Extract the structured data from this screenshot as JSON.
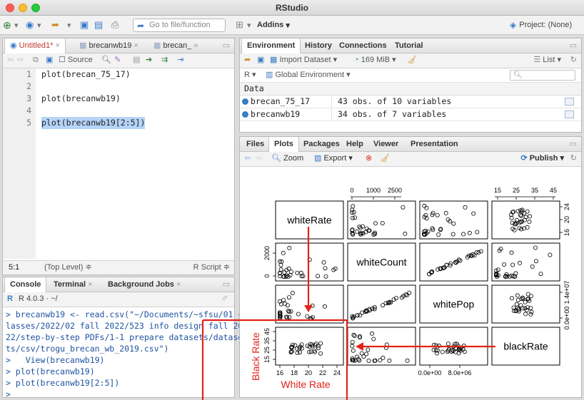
{
  "window": {
    "title": "RStudio"
  },
  "toolbar": {
    "goto_placeholder": "Go to file/function",
    "addins": "Addins",
    "project": "Project: (None)"
  },
  "editor": {
    "tabs": [
      "Untitled1*",
      "brecanwb19",
      "brecan_"
    ],
    "source_label": "Source",
    "lines": [
      {
        "n": "1",
        "code": "plot(brecan_75_17)"
      },
      {
        "n": "2",
        "code": ""
      },
      {
        "n": "3",
        "code": "plot(brecanwb19)"
      },
      {
        "n": "4",
        "code": ""
      },
      {
        "n": "5",
        "code": "plot(brecanwb19[2:5])"
      }
    ],
    "status_pos": "5:1",
    "status_scope": "(Top Level) ≑",
    "status_type": "R Script ≑"
  },
  "console": {
    "tabs": [
      "Console",
      "Terminal",
      "Background Jobs"
    ],
    "version": "R 4.0.3 · ~/",
    "lines": [
      "> brecanwb19 <- read.csv(\"~/Documents/~sfsu/01 c",
      "lasses/2022/02 fall 2022/523 info design fall 20",
      "22/step-by-step PDFs/1-1 prepare datasets/datase",
      "ts/csv/trogu_brecan_wb_2019.csv\")",
      ">   View(brecanwb19)",
      "> plot(brecanwb19)",
      "> plot(brecanwb19[2:5])",
      "> "
    ]
  },
  "environment": {
    "tabs": [
      "Environment",
      "History",
      "Connections",
      "Tutorial"
    ],
    "import_label": "Import Dataset",
    "memory": "169 MiB",
    "list_label": "List",
    "r_label": "R",
    "global_label": "Global Environment",
    "section": "Data",
    "rows": [
      {
        "name": "brecan_75_17",
        "desc": "43 obs. of 10 variables"
      },
      {
        "name": "brecanwb19",
        "desc": "34 obs. of 7 variables"
      }
    ]
  },
  "files": {
    "tabs": [
      "Files",
      "Plots",
      "Packages",
      "Help",
      "Viewer",
      "Presentation"
    ],
    "zoom": "Zoom",
    "export": "Export",
    "publish": "Publish"
  },
  "chart_data": {
    "type": "scatter",
    "variables": [
      "whiteRate",
      "whiteCount",
      "whitePop",
      "blackRate"
    ],
    "top_axis_ticks": [
      [
        "0",
        "1000",
        "2500"
      ],
      [
        "15",
        "25",
        "35",
        "45"
      ]
    ],
    "right_axis_ticks": [
      [
        "24",
        "20",
        "16"
      ],
      [
        "1.4e+07",
        "0.0e+00"
      ]
    ],
    "left_axis_ticks": [
      [
        "2000",
        "0"
      ],
      [
        "45",
        "35",
        "25",
        "15"
      ]
    ],
    "bottom_axis_ticks": [
      [
        "16",
        "18",
        "20",
        "22",
        "24"
      ],
      [
        "0.0e+00",
        "8.0e+06"
      ]
    ],
    "annotations": {
      "black_rate": "Black Rate",
      "white_rate": "White Rate"
    },
    "annotation_color": "#e2231a"
  }
}
